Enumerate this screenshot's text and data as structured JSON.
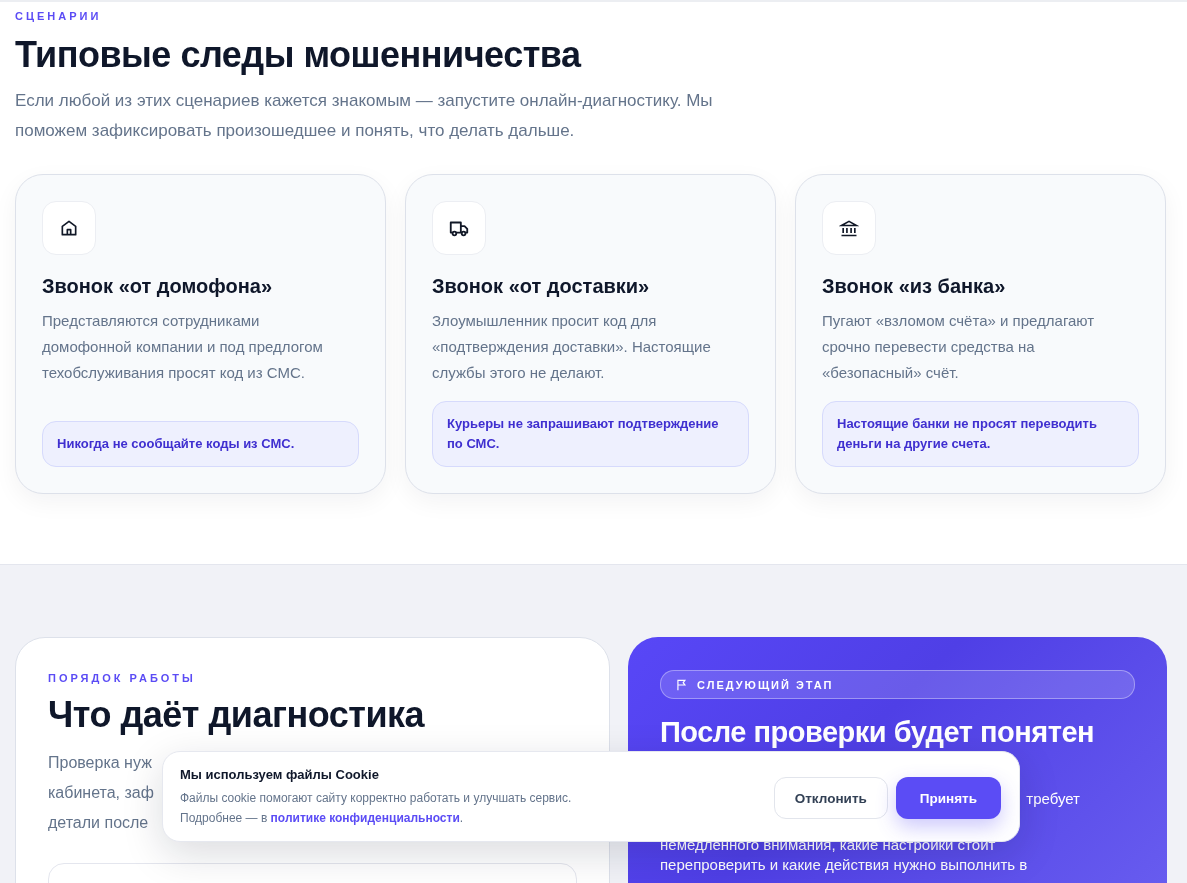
{
  "scenarios": {
    "eyebrow": "СЦЕНАРИИ",
    "title": "Типовые следы мошенничества",
    "subtitle": "Если любой из этих сценариев кажется знакомым — запустите онлайн-диагностику. Мы поможем зафиксировать произошедшее и понять, что делать дальше.",
    "cards": [
      {
        "title": "Звонок «от домофона»",
        "text": "Представляются сотрудниками домофонной компании и под предлогом техобслуживания просят код из СМС.",
        "tip": "Никогда не сообщайте коды из СМС."
      },
      {
        "title": "Звонок «от доставки»",
        "text": "Злоумышленник просит код для «подтверждения доставки». Настоящие службы этого не делают.",
        "tip": "Курьеры не запрашивают подтверждение по СМС."
      },
      {
        "title": "Звонок «из банка»",
        "text": "Пугают «взломом счёта» и предлагают срочно перевести средства на «безопасный» счёт.",
        "tip": "Настоящие банки не просят переводить деньги на другие счета."
      }
    ]
  },
  "process": {
    "eyebrow": "ПОРЯДОК РАБОТЫ",
    "title": "Что даёт диагностика",
    "text_lines": [
      "Проверка нуж",
      "кабинета, заф",
      "детали после"
    ]
  },
  "next_step": {
    "badge": "СЛЕДУЮЩИЙ ЭТАП",
    "title": "После проверки будет понятен",
    "text_lines": [
      "требует",
      "немедленного внимания, какие настройки стоит",
      "перепроверить и какие действия нужно выполнить в"
    ]
  },
  "cookie_banner": {
    "title": "Мы используем файлы Cookie",
    "text": "Файлы cookie помогают сайту корректно работать и улучшать сервис.",
    "more": "Подробнее — в",
    "link": "политике конфиденциальности",
    "after_link": ".",
    "buttons": [
      {
        "label": "Отклонить",
        "kind": "secondary"
      },
      {
        "label": "Принять",
        "kind": "primary"
      }
    ]
  }
}
